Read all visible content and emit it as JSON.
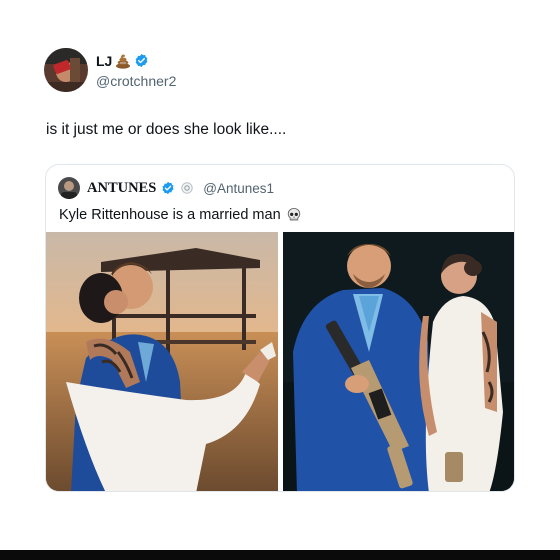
{
  "post": {
    "author_name": "LJ",
    "author_handle": "@crotchner2",
    "name_emoji": "poop-emoji",
    "verified_icon": "verified-badge-icon",
    "text": "is it just me or does she look like...."
  },
  "quoted": {
    "author_name": "ANTUNES",
    "author_handle": "@Antunes1",
    "verified_icon": "verified-badge-icon",
    "text": "Kyle Rittenhouse is a married man",
    "emoji": "skull-emoji",
    "photos": [
      "photo-wedding-pier-kiss",
      "photo-couple-with-rifle"
    ]
  },
  "colors": {
    "verified": "#1d9bf0",
    "handle": "#536471",
    "border": "#e1e6ea",
    "text": "#0f1419"
  }
}
